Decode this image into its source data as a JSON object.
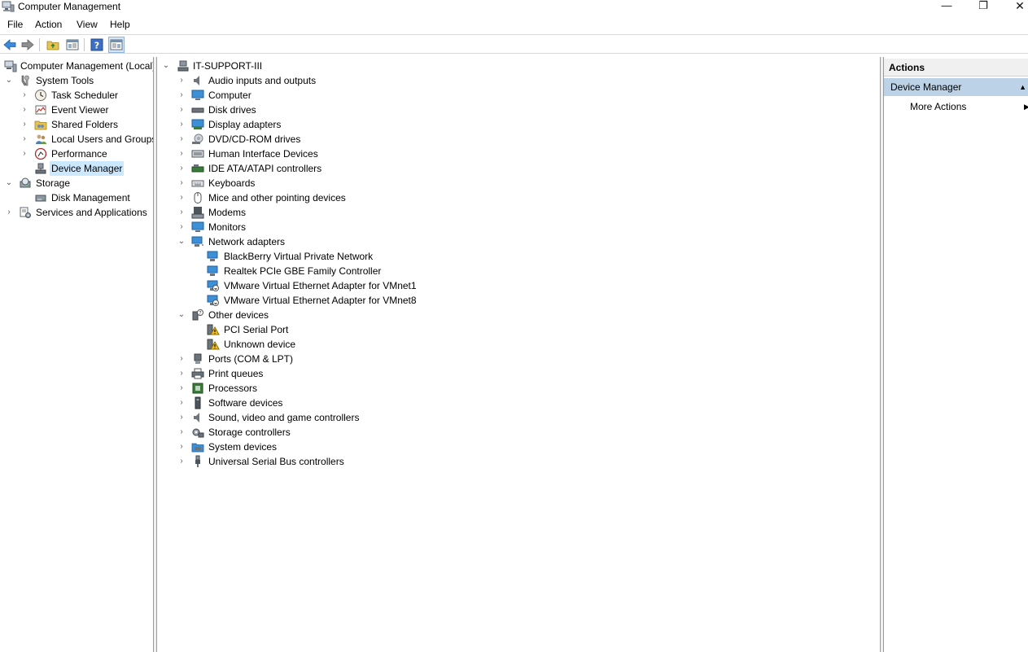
{
  "window": {
    "title": "Computer Management",
    "min_glyph": "—",
    "max_glyph": "❐",
    "close_glyph": "✕"
  },
  "menu": {
    "items": [
      "File",
      "Action",
      "View",
      "Help"
    ]
  },
  "toolbar": {
    "buttons": [
      "back-icon",
      "forward-icon",
      "up-folder-icon",
      "show-hide-tree-icon",
      "help-icon",
      "show-hide-action-pane-icon"
    ]
  },
  "left_tree": {
    "root": "Computer Management (Local)",
    "system_tools": "System Tools",
    "items": [
      "Task Scheduler",
      "Event Viewer",
      "Shared Folders",
      "Local Users and Groups",
      "Performance",
      "Device Manager"
    ],
    "storage": "Storage",
    "disk_management": "Disk Management",
    "services": "Services and Applications"
  },
  "device_tree": {
    "root": "IT-SUPPORT-III",
    "categories": [
      "Audio inputs and outputs",
      "Computer",
      "Disk drives",
      "Display adapters",
      "DVD/CD-ROM drives",
      "Human Interface Devices",
      "IDE ATA/ATAPI controllers",
      "Keyboards",
      "Mice and other pointing devices",
      "Modems",
      "Monitors"
    ],
    "network_adapters": "Network adapters",
    "network_children": [
      "BlackBerry Virtual Private Network",
      "Realtek PCIe GBE Family Controller",
      "VMware Virtual Ethernet Adapter for VMnet1",
      "VMware Virtual Ethernet Adapter for VMnet8"
    ],
    "other_devices": "Other devices",
    "other_children": [
      "PCI Serial Port",
      "Unknown device"
    ],
    "categories_after": [
      "Ports (COM & LPT)",
      "Print queues",
      "Processors",
      "Software devices",
      "Sound, video and game controllers",
      "Storage controllers",
      "System devices",
      "Universal Serial Bus controllers"
    ]
  },
  "actions": {
    "header": "Actions",
    "section": "Device Manager",
    "more_actions": "More Actions"
  },
  "colors": {
    "selection": "#cce8ff",
    "actions_section": "#bcd2e6",
    "monitor_blue": "#3d8fd6",
    "warning_yellow": "#f2c01e"
  }
}
